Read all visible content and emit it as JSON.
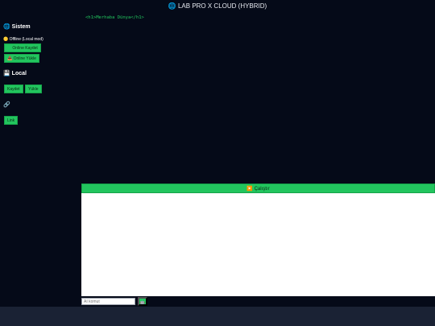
{
  "header": {
    "icon": "🌐",
    "title": "LAB PRO X CLOUD (HYBRID)"
  },
  "sidebar": {
    "system": {
      "icon": "🌐",
      "title": "Sistem"
    },
    "status": {
      "icon": "🟡",
      "text": "Offline (Local mod)"
    },
    "online_save": {
      "icon": "☁",
      "label": "Online Kaydet"
    },
    "online_load": {
      "icon": "📥",
      "label": "Online Yükle"
    },
    "local": {
      "icon": "💾",
      "title": "Local"
    },
    "local_save": "Kaydet",
    "local_load": "Yükle",
    "link_section": {
      "icon": "🔗"
    },
    "link_button": "Link"
  },
  "editor": {
    "code": "<h1>Merhaba Dünya</h1>"
  },
  "run_bar": {
    "icon": "▶️",
    "label": "Çalıştır"
  },
  "command": {
    "placeholder": "AI komut",
    "send_icon": "🤖"
  }
}
